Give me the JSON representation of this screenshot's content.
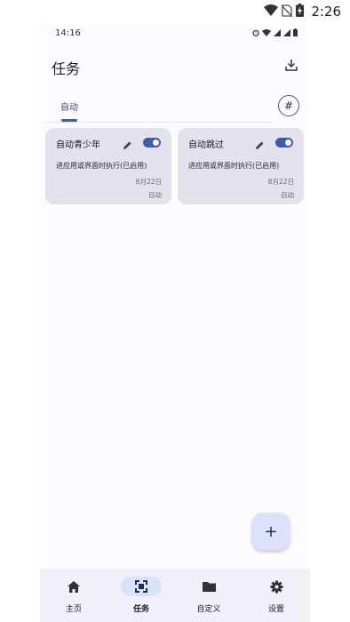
{
  "device_status": {
    "time": "2:26",
    "icons": [
      "wifi-icon",
      "no-sim-icon",
      "battery-charging-icon"
    ]
  },
  "app_status": {
    "time": "14:16",
    "icons": [
      "alarm-icon",
      "wifi-icon",
      "signal-icon",
      "signal-icon",
      "battery-icon"
    ]
  },
  "header": {
    "title": "任务",
    "download_icon": "download-icon"
  },
  "tabs": {
    "active_label": "自动",
    "hash_label": "#"
  },
  "cards": [
    {
      "name": "自动青少年",
      "description": "进应用或界面时执行(已启用)",
      "date": "8月22日",
      "tag": "自动",
      "enabled": true
    },
    {
      "name": "自动跳过",
      "description": "进应用或界面时执行(已启用)",
      "date": "8月22日",
      "tag": "自动",
      "enabled": true
    }
  ],
  "fab": {
    "label": "+"
  },
  "bottom_nav": [
    {
      "label": "主页",
      "icon": "home-icon",
      "active": false
    },
    {
      "label": "任务",
      "icon": "task-icon",
      "active": true
    },
    {
      "label": "自定义",
      "icon": "folder-icon",
      "active": false
    },
    {
      "label": "设置",
      "icon": "settings-icon",
      "active": false
    }
  ],
  "colors": {
    "accent": "#3e5bb0",
    "card_bg": "#e1e2ec",
    "nav_bg": "#eff0f8",
    "active_pill": "#dae2fb"
  }
}
